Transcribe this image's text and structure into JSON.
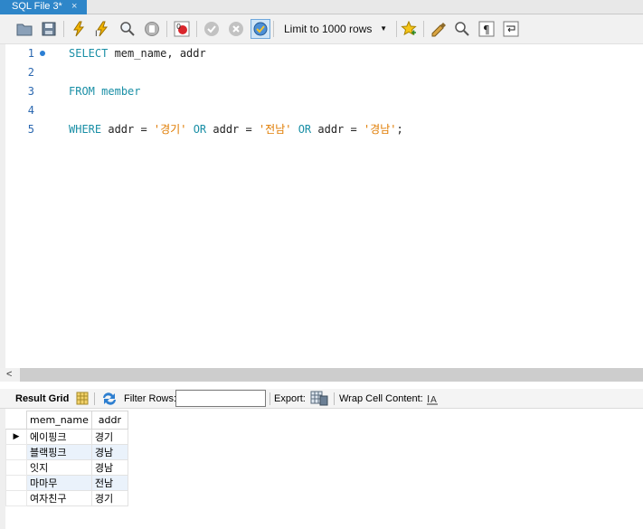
{
  "tab": {
    "title": "SQL File 3*",
    "close": "×"
  },
  "toolbar": {
    "buttons": [
      {
        "name": "open-file-icon"
      },
      {
        "name": "save-icon"
      },
      {
        "name": "execute-icon"
      },
      {
        "name": "execute-current-icon"
      },
      {
        "name": "explain-icon"
      },
      {
        "name": "stop-icon"
      },
      {
        "name": "toggle-error-icon"
      },
      {
        "name": "commit-icon"
      },
      {
        "name": "rollback-icon"
      },
      {
        "name": "autocommit-icon"
      },
      {
        "name": "add-snippet-icon"
      },
      {
        "name": "beautify-icon"
      },
      {
        "name": "find-icon"
      },
      {
        "name": "invisible-chars-icon"
      },
      {
        "name": "word-wrap-icon"
      }
    ],
    "limit_label": "Limit to 1000 rows"
  },
  "editor": {
    "lines": [
      {
        "num": "1",
        "parts": [
          {
            "t": "SELECT",
            "k": "kw"
          },
          {
            "t": " mem_name, addr",
            "k": ""
          }
        ]
      },
      {
        "num": "2",
        "parts": []
      },
      {
        "num": "3",
        "parts": [
          {
            "t": "FROM",
            "k": "kw"
          },
          {
            "t": " ",
            "k": ""
          },
          {
            "t": "member",
            "k": "kw"
          }
        ]
      },
      {
        "num": "4",
        "parts": []
      },
      {
        "num": "5",
        "parts": [
          {
            "t": "WHERE",
            "k": "kw"
          },
          {
            "t": " addr = ",
            "k": ""
          },
          {
            "t": "'경기'",
            "k": "str"
          },
          {
            "t": " ",
            "k": ""
          },
          {
            "t": "OR",
            "k": "kw"
          },
          {
            "t": " addr = ",
            "k": ""
          },
          {
            "t": "'전남'",
            "k": "str"
          },
          {
            "t": " ",
            "k": ""
          },
          {
            "t": "OR",
            "k": "kw"
          },
          {
            "t": " addr = ",
            "k": ""
          },
          {
            "t": "'경남'",
            "k": "str"
          },
          {
            "t": ";",
            "k": ""
          }
        ]
      }
    ]
  },
  "hscroll": {
    "left_arrow": "<"
  },
  "results": {
    "result_grid_label": "Result Grid",
    "filter_label": "Filter Rows:",
    "filter_value": "",
    "export_label": "Export:",
    "wrap_label": "Wrap Cell Content:",
    "columns": [
      "mem_name",
      "addr"
    ],
    "rows": [
      [
        "에이핑크",
        "경기"
      ],
      [
        "블랙핑크",
        "경남"
      ],
      [
        "잇지",
        "경남"
      ],
      [
        "마마무",
        "전남"
      ],
      [
        "여자친구",
        "경기"
      ]
    ],
    "current_row_marker": "▶"
  },
  "colors": {
    "tab_active": "#2e86c9",
    "keyword": "#1a8fa6",
    "string": "#e07b00",
    "line_number": "#2b68b0",
    "alt_row": "#eaf2fb"
  }
}
